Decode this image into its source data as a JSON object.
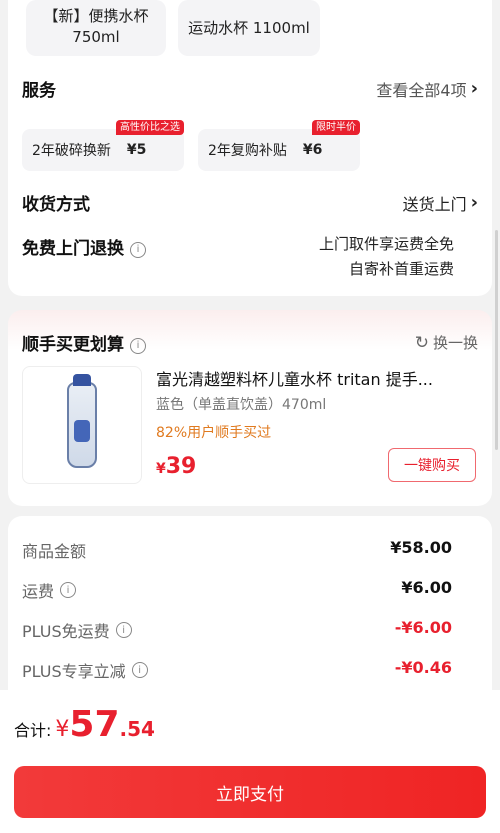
{
  "variants": [
    {
      "line1": "【新】便携水杯",
      "line2": "750ml"
    },
    {
      "line1": "运动水杯 1100ml"
    }
  ],
  "service": {
    "title": "服务",
    "link": "查看全部4项",
    "chips": [
      {
        "name": "2年破碎换新",
        "price": "¥5",
        "tag": "高性价比之选"
      },
      {
        "name": "2年复购补贴",
        "price": "¥6",
        "tag": "限时半价"
      }
    ]
  },
  "delivery": {
    "title": "收货方式",
    "value": "送货上门"
  },
  "returns": {
    "title": "免费上门退换",
    "line1": "上门取件享运费全免",
    "line2": "自寄补首重运费"
  },
  "bundle": {
    "title": "顺手买更划算",
    "refresh": "换一换",
    "product": {
      "title": "富光清越塑料杯儿童水杯 tritan 提手...",
      "spec": "蓝色（单盖直饮盖）470ml",
      "bought": "82%用户顺手买过",
      "currency": "¥",
      "price": "39",
      "button": "一键购买"
    }
  },
  "prices": [
    {
      "label": "商品金额",
      "value": "¥58.00",
      "info": false,
      "red": false
    },
    {
      "label": "运费",
      "value": "¥6.00",
      "info": true,
      "red": false
    },
    {
      "label": "PLUS免运费",
      "value": "-¥6.00",
      "info": true,
      "red": true
    },
    {
      "label": "PLUS专享立减",
      "value": "-¥0.46",
      "info": true,
      "red": true
    }
  ],
  "total": {
    "label": "合计:",
    "currency": "¥",
    "integer": "57",
    "decimal": ".54"
  },
  "pay_button": "立即支付",
  "colors": {
    "accent": "#e8202e",
    "orange": "#e07a1f"
  }
}
